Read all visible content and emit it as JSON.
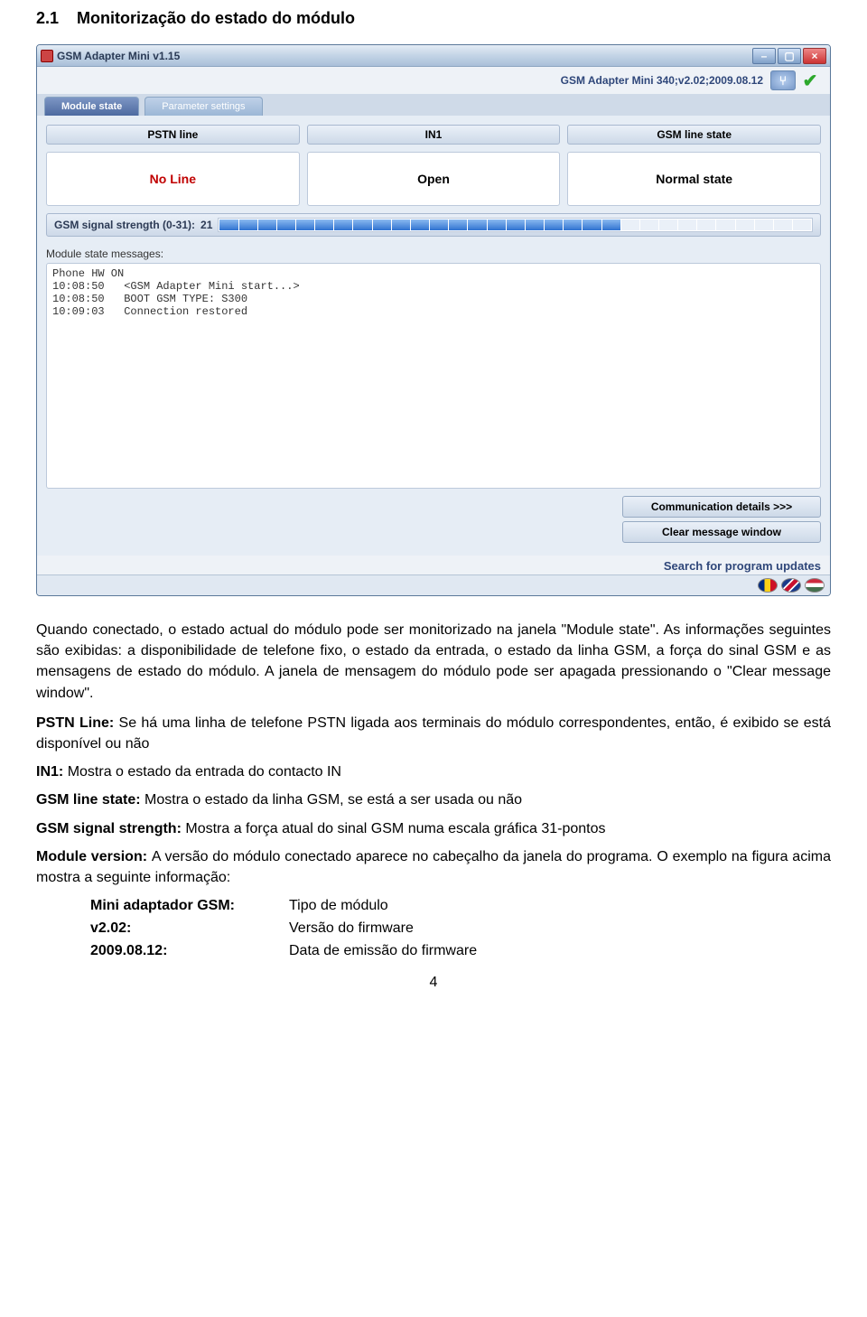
{
  "document": {
    "heading_num": "2.1",
    "heading": "Monitorização do estado do módulo",
    "para1": "Quando conectado, o estado actual do módulo pode ser monitorizado na janela \"Module state\". As informações seguintes são exibidas: a disponibilidade de telefone fixo, o estado da entrada, o estado da linha GSM, a força do sinal GSM e as mensagens de estado do módulo. A janela de mensagem do módulo pode ser apagada pressionando o \"Clear message window\".",
    "defs": {
      "pstn_k": "PSTN Line:",
      "pstn_v": "Se há uma linha de telefone PSTN ligada aos terminais do módulo correspondentes, então, é exibido se está disponível ou não",
      "in1_k": "IN1:",
      "in1_v": "Mostra o estado da entrada do contacto IN",
      "gls_k": "GSM line state:",
      "gls_v": "Mostra o estado da linha GSM, se está a ser usada ou não",
      "gss_k": "GSM signal strength:",
      "gss_v": "Mostra a força atual do sinal GSM numa escala gráfica 31-pontos",
      "mv_k": "Module version:",
      "mv_v": "A versão do módulo conectado aparece no cabeçalho da janela do programa. O exemplo na figura acima mostra a seguinte informação:",
      "sub1_k": "Mini adaptador GSM:",
      "sub1_v": "Tipo de módulo",
      "sub2_k": "v2.02:",
      "sub2_v": "Versão do firmware",
      "sub3_k": "2009.08.12:",
      "sub3_v": "Data de emissão do firmware"
    },
    "page_num": "4"
  },
  "window": {
    "title": "GSM Adapter Mini v1.15",
    "device_info": "GSM Adapter Mini 340;v2.02;2009.08.12",
    "tabs": {
      "module_state": "Module state",
      "param_settings": "Parameter settings"
    },
    "headers": {
      "pstn": "PSTN line",
      "in1": "IN1",
      "gsm_state": "GSM line state"
    },
    "values": {
      "pstn": "No Line",
      "in1": "Open",
      "gsm_state": "Normal state"
    },
    "signal": {
      "label": "GSM signal strength (0-31):",
      "value": "21",
      "total": 31
    },
    "messages_label": "Module state messages:",
    "messages": "Phone HW ON\n10:08:50   <GSM Adapter Mini start...>\n10:08:50   BOOT GSM TYPE: S300\n10:09:03   Connection restored",
    "buttons": {
      "details": "Communication details >>>",
      "clear": "Clear message window"
    },
    "link": "Search for program updates"
  }
}
